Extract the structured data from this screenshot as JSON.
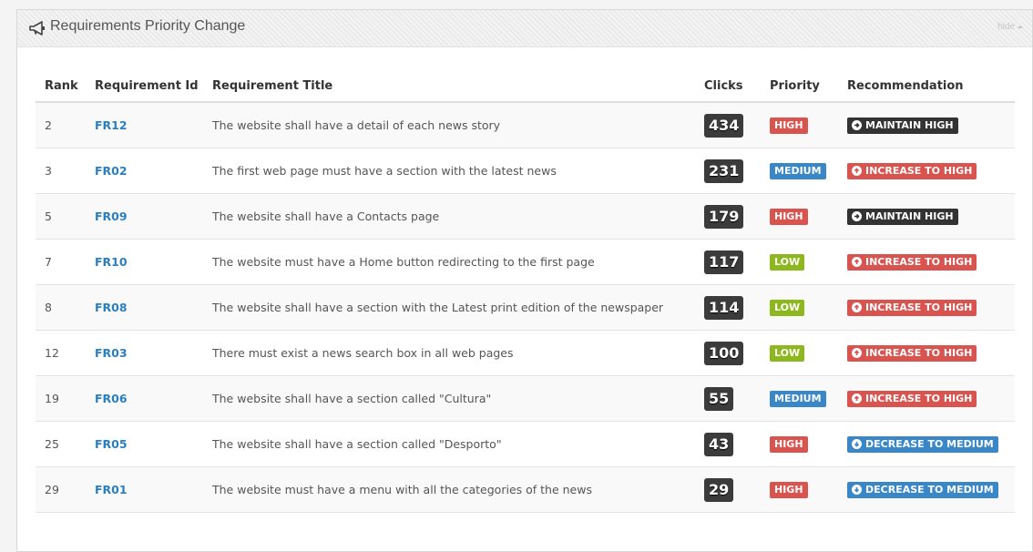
{
  "panel": {
    "title": "Requirements Priority Change",
    "hide_label": "hide"
  },
  "table": {
    "headers": [
      "Rank",
      "Requirement Id",
      "Requirement Title",
      "Clicks",
      "Priority",
      "Recommendation"
    ],
    "rows": [
      {
        "rank": "2",
        "id": "FR12",
        "title": "The website shall have a detail of each news story",
        "clicks": "434",
        "priority": "HIGH",
        "recommendation": "MAINTAIN HIGH"
      },
      {
        "rank": "3",
        "id": "FR02",
        "title": "The first web page must have a section with the latest news",
        "clicks": "231",
        "priority": "MEDIUM",
        "recommendation": "INCREASE TO HIGH"
      },
      {
        "rank": "5",
        "id": "FR09",
        "title": "The website shall have a Contacts page",
        "clicks": "179",
        "priority": "HIGH",
        "recommendation": "MAINTAIN HIGH"
      },
      {
        "rank": "7",
        "id": "FR10",
        "title": "The website must have a Home button redirecting to the first page",
        "clicks": "117",
        "priority": "LOW",
        "recommendation": "INCREASE TO HIGH"
      },
      {
        "rank": "8",
        "id": "FR08",
        "title": "The website shall have a section with the Latest print edition of the newspaper",
        "clicks": "114",
        "priority": "LOW",
        "recommendation": "INCREASE TO HIGH"
      },
      {
        "rank": "12",
        "id": "FR03",
        "title": "There must exist a news search box in all web pages",
        "clicks": "100",
        "priority": "LOW",
        "recommendation": "INCREASE TO HIGH"
      },
      {
        "rank": "19",
        "id": "FR06",
        "title": "The website shall have a section called \"Cultura\"",
        "clicks": "55",
        "priority": "MEDIUM",
        "recommendation": "INCREASE TO HIGH"
      },
      {
        "rank": "25",
        "id": "FR05",
        "title": "The website shall have a section called \"Desporto\"",
        "clicks": "43",
        "priority": "HIGH",
        "recommendation": "DECREASE TO MEDIUM"
      },
      {
        "rank": "29",
        "id": "FR01",
        "title": "The website must have a menu with all the categories of the news",
        "clicks": "29",
        "priority": "HIGH",
        "recommendation": "DECREASE TO MEDIUM"
      }
    ]
  },
  "colors": {
    "HIGH": "#d9534f",
    "MEDIUM": "#3a87c8",
    "LOW": "#8cb81d",
    "MAINTAIN HIGH": "#333333",
    "INCREASE TO HIGH": "#d9534f",
    "DECREASE TO MEDIUM": "#3a87c8"
  },
  "icons": {
    "header": "bullhorn-icon",
    "hide": "caret-up-icon",
    "MAINTAIN HIGH": "circle-arrow-right-icon",
    "INCREASE TO HIGH": "circle-arrow-up-icon",
    "DECREASE TO MEDIUM": "circle-arrow-down-icon"
  }
}
